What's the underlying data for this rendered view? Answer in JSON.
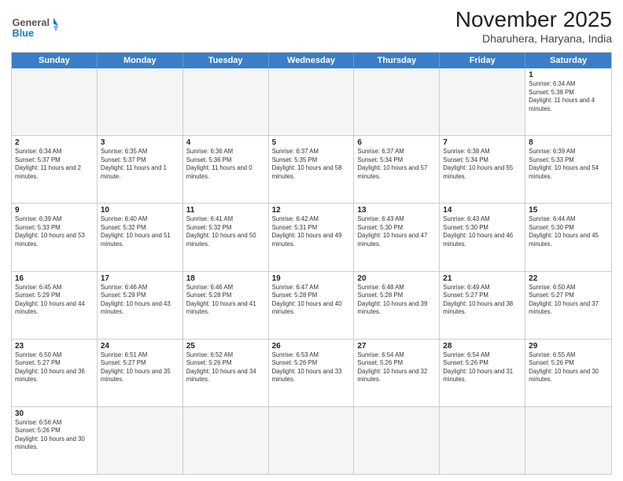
{
  "header": {
    "logo_general": "General",
    "logo_blue": "Blue",
    "title": "November 2025",
    "subtitle": "Dharuhera, Haryana, India"
  },
  "days_of_week": [
    "Sunday",
    "Monday",
    "Tuesday",
    "Wednesday",
    "Thursday",
    "Friday",
    "Saturday"
  ],
  "rows": [
    [
      {
        "day": "",
        "text": ""
      },
      {
        "day": "",
        "text": ""
      },
      {
        "day": "",
        "text": ""
      },
      {
        "day": "",
        "text": ""
      },
      {
        "day": "",
        "text": ""
      },
      {
        "day": "",
        "text": ""
      },
      {
        "day": "1",
        "text": "Sunrise: 6:34 AM\nSunset: 5:38 PM\nDaylight: 11 hours and 4 minutes."
      }
    ],
    [
      {
        "day": "2",
        "text": "Sunrise: 6:34 AM\nSunset: 5:37 PM\nDaylight: 11 hours and 2 minutes."
      },
      {
        "day": "3",
        "text": "Sunrise: 6:35 AM\nSunset: 5:37 PM\nDaylight: 11 hours and 1 minute."
      },
      {
        "day": "4",
        "text": "Sunrise: 6:36 AM\nSunset: 5:36 PM\nDaylight: 11 hours and 0 minutes."
      },
      {
        "day": "5",
        "text": "Sunrise: 6:37 AM\nSunset: 5:35 PM\nDaylight: 10 hours and 58 minutes."
      },
      {
        "day": "6",
        "text": "Sunrise: 6:37 AM\nSunset: 5:34 PM\nDaylight: 10 hours and 57 minutes."
      },
      {
        "day": "7",
        "text": "Sunrise: 6:38 AM\nSunset: 5:34 PM\nDaylight: 10 hours and 55 minutes."
      },
      {
        "day": "8",
        "text": "Sunrise: 6:39 AM\nSunset: 5:33 PM\nDaylight: 10 hours and 54 minutes."
      }
    ],
    [
      {
        "day": "9",
        "text": "Sunrise: 6:39 AM\nSunset: 5:33 PM\nDaylight: 10 hours and 53 minutes."
      },
      {
        "day": "10",
        "text": "Sunrise: 6:40 AM\nSunset: 5:32 PM\nDaylight: 10 hours and 51 minutes."
      },
      {
        "day": "11",
        "text": "Sunrise: 6:41 AM\nSunset: 5:32 PM\nDaylight: 10 hours and 50 minutes."
      },
      {
        "day": "12",
        "text": "Sunrise: 6:42 AM\nSunset: 5:31 PM\nDaylight: 10 hours and 49 minutes."
      },
      {
        "day": "13",
        "text": "Sunrise: 6:43 AM\nSunset: 5:30 PM\nDaylight: 10 hours and 47 minutes."
      },
      {
        "day": "14",
        "text": "Sunrise: 6:43 AM\nSunset: 5:30 PM\nDaylight: 10 hours and 46 minutes."
      },
      {
        "day": "15",
        "text": "Sunrise: 6:44 AM\nSunset: 5:30 PM\nDaylight: 10 hours and 45 minutes."
      }
    ],
    [
      {
        "day": "16",
        "text": "Sunrise: 6:45 AM\nSunset: 5:29 PM\nDaylight: 10 hours and 44 minutes."
      },
      {
        "day": "17",
        "text": "Sunrise: 6:46 AM\nSunset: 5:29 PM\nDaylight: 10 hours and 43 minutes."
      },
      {
        "day": "18",
        "text": "Sunrise: 6:46 AM\nSunset: 5:28 PM\nDaylight: 10 hours and 41 minutes."
      },
      {
        "day": "19",
        "text": "Sunrise: 6:47 AM\nSunset: 5:28 PM\nDaylight: 10 hours and 40 minutes."
      },
      {
        "day": "20",
        "text": "Sunrise: 6:48 AM\nSunset: 5:28 PM\nDaylight: 10 hours and 39 minutes."
      },
      {
        "day": "21",
        "text": "Sunrise: 6:49 AM\nSunset: 5:27 PM\nDaylight: 10 hours and 38 minutes."
      },
      {
        "day": "22",
        "text": "Sunrise: 6:50 AM\nSunset: 5:27 PM\nDaylight: 10 hours and 37 minutes."
      }
    ],
    [
      {
        "day": "23",
        "text": "Sunrise: 6:50 AM\nSunset: 5:27 PM\nDaylight: 10 hours and 36 minutes."
      },
      {
        "day": "24",
        "text": "Sunrise: 6:51 AM\nSunset: 5:27 PM\nDaylight: 10 hours and 35 minutes."
      },
      {
        "day": "25",
        "text": "Sunrise: 6:52 AM\nSunset: 5:26 PM\nDaylight: 10 hours and 34 minutes."
      },
      {
        "day": "26",
        "text": "Sunrise: 6:53 AM\nSunset: 5:26 PM\nDaylight: 10 hours and 33 minutes."
      },
      {
        "day": "27",
        "text": "Sunrise: 6:54 AM\nSunset: 5:26 PM\nDaylight: 10 hours and 32 minutes."
      },
      {
        "day": "28",
        "text": "Sunrise: 6:54 AM\nSunset: 5:26 PM\nDaylight: 10 hours and 31 minutes."
      },
      {
        "day": "29",
        "text": "Sunrise: 6:55 AM\nSunset: 5:26 PM\nDaylight: 10 hours and 30 minutes."
      }
    ],
    [
      {
        "day": "30",
        "text": "Sunrise: 6:56 AM\nSunset: 5:26 PM\nDaylight: 10 hours and 30 minutes."
      },
      {
        "day": "",
        "text": ""
      },
      {
        "day": "",
        "text": ""
      },
      {
        "day": "",
        "text": ""
      },
      {
        "day": "",
        "text": ""
      },
      {
        "day": "",
        "text": ""
      },
      {
        "day": "",
        "text": ""
      }
    ]
  ]
}
